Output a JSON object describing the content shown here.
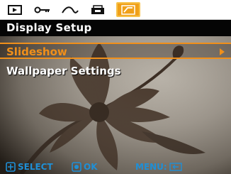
{
  "tabs": [
    {
      "icon": "playback-icon"
    },
    {
      "icon": "key-icon"
    },
    {
      "icon": "curve-icon"
    },
    {
      "icon": "print-icon"
    },
    {
      "icon": "setup-icon",
      "active": true
    }
  ],
  "title": "Display Setup",
  "menu": {
    "items": [
      {
        "label": "Slideshow",
        "selected": true
      },
      {
        "label": "Wallpaper Settings",
        "selected": false
      }
    ]
  },
  "hints": {
    "select": "SELECT",
    "ok": "OK",
    "menu": "MENU:"
  },
  "colors": {
    "accent": "#f08f1a",
    "hint": "#1f8fd6",
    "active_tab": "#f0a018"
  }
}
